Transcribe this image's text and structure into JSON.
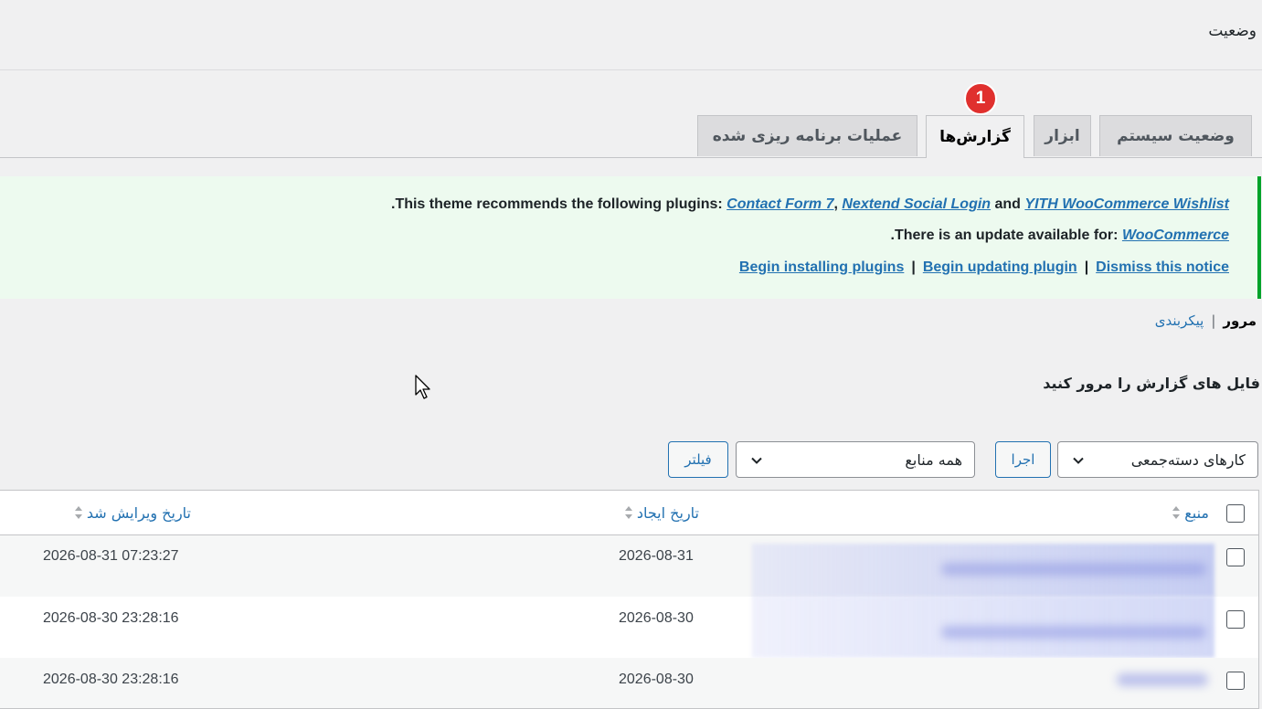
{
  "header": {
    "title": "وضعیت"
  },
  "tabs": [
    {
      "label": "وضعیت سیستم",
      "active": false
    },
    {
      "label": "ابزار",
      "active": false
    },
    {
      "label": "گزارش‌ها",
      "active": true,
      "badge": "1"
    },
    {
      "label": "عملیات برنامه ریزی شده",
      "active": false
    }
  ],
  "notice": {
    "line1_prefix": "This theme recommends the following plugins: ",
    "plugin1": "Contact Form 7",
    "comma": ", ",
    "plugin2": "Nextend Social Login",
    "and": " and ",
    "plugin3": "YITH WooCommerce Wishlist",
    "line1_end": ".",
    "line2_prefix": "There is an update available for: ",
    "update_plugin": "WooCommerce",
    "line2_end": ".",
    "action1": "Begin installing plugins",
    "action2": "Begin updating plugin",
    "action3": "Dismiss this notice",
    "separator": "|",
    "accent_color": "#00a32a"
  },
  "subnav": {
    "current": "مرور",
    "separator": "|",
    "link": "پیکربندی"
  },
  "section_title": "فایل های گزارش را مرور کنید",
  "controls": {
    "bulk_actions": "کارهای دسته‌جمعی",
    "apply": "اجرا",
    "sources": "همه منابع",
    "filter": "فیلتر"
  },
  "table": {
    "columns": {
      "source": "منبع",
      "created": "تاریخ ایجاد",
      "modified": "تاریخ ویرایش شد"
    },
    "rows": [
      {
        "created": "2026-08-31",
        "modified": "2026-08-31 07:23:27"
      },
      {
        "created": "2026-08-30",
        "modified": "2026-08-30 23:28:16"
      },
      {
        "created": "2026-08-30",
        "modified": "2026-08-30 23:28:16"
      }
    ]
  },
  "colors": {
    "link": "#2271b1",
    "badge": "#e0302e"
  }
}
